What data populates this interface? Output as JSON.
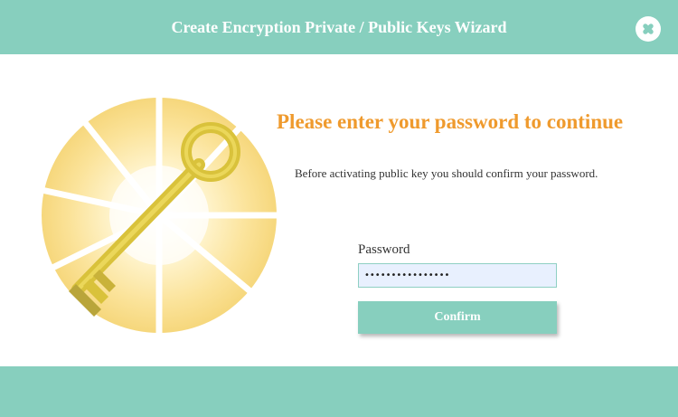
{
  "window": {
    "title": "Create Encryption Private / Public Keys Wizard",
    "close_icon": "close-icon"
  },
  "main": {
    "illustration_icon": "golden-key-icon",
    "heading": "Please enter your password to continue",
    "description": "Before activating public key you should confirm your password.",
    "password_label": "Password",
    "password_value": "••••••••••••••••",
    "confirm_label": "Confirm"
  },
  "colors": {
    "accent": "#87cfbe",
    "heading": "#ef9a2d",
    "key_gold": "#d9c23b",
    "input_bg": "#e8f0fe"
  }
}
